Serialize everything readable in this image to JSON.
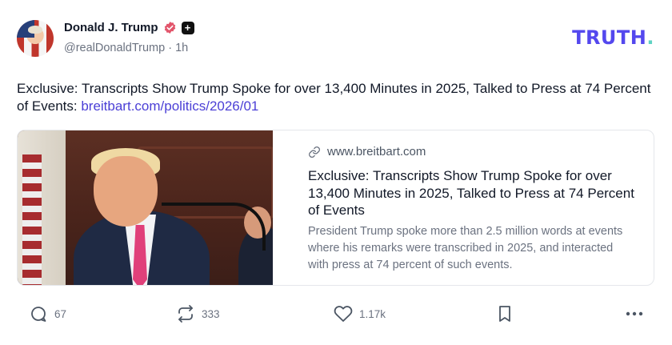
{
  "post": {
    "author_name": "Donald J. Trump",
    "handle": "@realDonaldTrump",
    "separator": "·",
    "timestamp": "1h",
    "text": "Exclusive: Transcripts Show Trump Spoke for over 13,400 Minutes in 2025, Talked to Press at 74 Percent of Events: ",
    "link_text": "breitbart.com/politics/2026/01"
  },
  "brand": {
    "logo_text": "TRUTH",
    "logo_dot": ".",
    "accent_color": "#5448ee",
    "dot_color": "#5fd3c3"
  },
  "card": {
    "domain": "www.breitbart.com",
    "title": "Exclusive: Transcripts Show Trump Spoke for over 13,400 Minutes in 2025, Talked to Press at 74 Percent of Events",
    "description": "President Trump spoke more than 2.5 million words at events where his remarks were transcribed in 2025, and interacted with press at 74 percent of such events."
  },
  "actions": {
    "replies": "67",
    "retruths": "333",
    "likes": "1.17k"
  },
  "icons": [
    "verified-icon",
    "plus-badge-icon",
    "link-icon",
    "reply-icon",
    "retruth-icon",
    "like-icon",
    "bookmark-icon",
    "more-icon"
  ]
}
